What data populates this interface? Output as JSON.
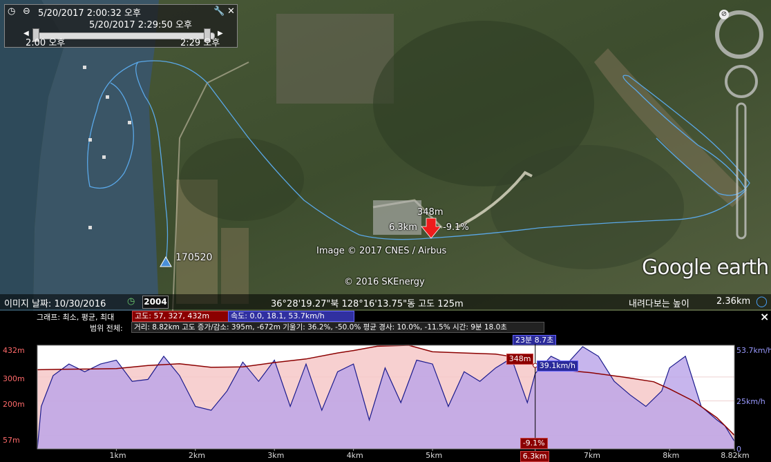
{
  "timeslider": {
    "start_datetime": "5/20/2017   2:00:32 오후",
    "end_datetime": "5/20/2017   2:29:50 오후",
    "left_label": "2:00 오후",
    "right_label": "2:29 오후"
  },
  "map": {
    "marker_label": "170520",
    "cursor_altitude": "348m",
    "cursor_distance": "6.3km",
    "cursor_slope": "-9.1%",
    "image_credit": "Image © 2017 CNES / Airbus",
    "data_credit": "© 2016 SKEnergy",
    "logo": "Google earth"
  },
  "statusbar": {
    "imagery_date": "이미지 날짜: 10/30/2016",
    "year": "2004",
    "coords": "36°28'19.27\"북 128°16'13.75\"동  고도    125m",
    "eye_alt_label": "내려다보는 높이",
    "eye_alt_value": "2.36km"
  },
  "profile": {
    "graph_label": "그래프: 최소, 평균, 최대",
    "elev_stats": "고도: 57, 327, 432m",
    "speed_stats": "속도: 0.0, 18.1, 53.7km/h",
    "range_label": "범위 전체:",
    "range_stats": "거리: 8.82km 고도 증가/감소: 395m, -672m 기울기: 36.2%, -50.0% 평균 경사: 10.0%, -11.5% 시간: 9분 18.0초",
    "time_tag": "23분 8.7초",
    "alt_tag": "348m",
    "speed_tag": "39.1km/h",
    "slope_tag": "-9.1%",
    "dist_tag": "6.3km",
    "close_label": "×",
    "colors": {
      "elevation": "#8b0000",
      "speed": "#1a1a8c",
      "alt_tag_bg": "#8b0000",
      "speed_tag_bg": "#2a2a9a"
    }
  },
  "chart_data": {
    "type": "area",
    "title": "",
    "xlabel": "",
    "ylabel": "",
    "x_ticks": [
      "1km",
      "2km",
      "3km",
      "4km",
      "5km",
      "6.3km",
      "7km",
      "8km",
      "8.82km"
    ],
    "x_tick_values": [
      1,
      2,
      3,
      4,
      5,
      6.3,
      7,
      8,
      8.82
    ],
    "xlim": [
      0,
      8.82
    ],
    "y_left_ticks": [
      "432m",
      "300m",
      "200m",
      "57m"
    ],
    "y_left_tick_values": [
      432,
      300,
      200,
      57
    ],
    "y_left_lim": [
      0,
      432
    ],
    "y_right_ticks": [
      "53.7km/h",
      "25km/h",
      "0"
    ],
    "y_right_tick_values": [
      53.7,
      25,
      0
    ],
    "y_right_lim": [
      0,
      53.7
    ],
    "series": [
      {
        "name": "고도",
        "axis": "left",
        "x": [
          0,
          0.3,
          0.6,
          1.0,
          1.4,
          1.8,
          2.2,
          2.6,
          3.0,
          3.4,
          3.8,
          4.0,
          4.3,
          4.7,
          5.0,
          5.4,
          5.8,
          6.0,
          6.3,
          6.6,
          7.0,
          7.4,
          7.8,
          8.0,
          8.3,
          8.6,
          8.82
        ],
        "values": [
          330,
          332,
          333,
          335,
          348,
          355,
          340,
          342,
          360,
          375,
          400,
          410,
          428,
          432,
          405,
          400,
          395,
          385,
          348,
          330,
          318,
          300,
          280,
          250,
          200,
          130,
          57
        ]
      },
      {
        "name": "속도",
        "axis": "right",
        "x": [
          0,
          0.05,
          0.2,
          0.4,
          0.6,
          0.8,
          1.0,
          1.2,
          1.4,
          1.6,
          1.8,
          2.0,
          2.2,
          2.4,
          2.6,
          2.8,
          3.0,
          3.2,
          3.4,
          3.6,
          3.8,
          4.0,
          4.2,
          4.4,
          4.6,
          4.8,
          5.0,
          5.2,
          5.4,
          5.6,
          5.8,
          6.0,
          6.2,
          6.3,
          6.5,
          6.7,
          6.9,
          7.1,
          7.3,
          7.5,
          7.7,
          7.9,
          8.0,
          8.2,
          8.4,
          8.6,
          8.7,
          8.82
        ],
        "values": [
          0,
          22,
          38,
          44,
          40,
          44,
          46,
          35,
          36,
          48,
          38,
          22,
          20,
          30,
          45,
          35,
          46,
          22,
          44,
          20,
          40,
          44,
          15,
          42,
          24,
          46,
          44,
          22,
          40,
          35,
          42,
          47,
          24,
          39.1,
          48,
          44,
          53,
          48,
          35,
          28,
          22,
          30,
          42,
          48,
          22,
          15,
          12,
          4
        ]
      }
    ],
    "annotations": [
      {
        "label": "23분 8.7초",
        "x": 6.3
      },
      {
        "label": "348m",
        "x": 6.3
      },
      {
        "label": "39.1km/h",
        "x": 6.3
      },
      {
        "label": "-9.1%",
        "x": 6.3
      }
    ]
  }
}
